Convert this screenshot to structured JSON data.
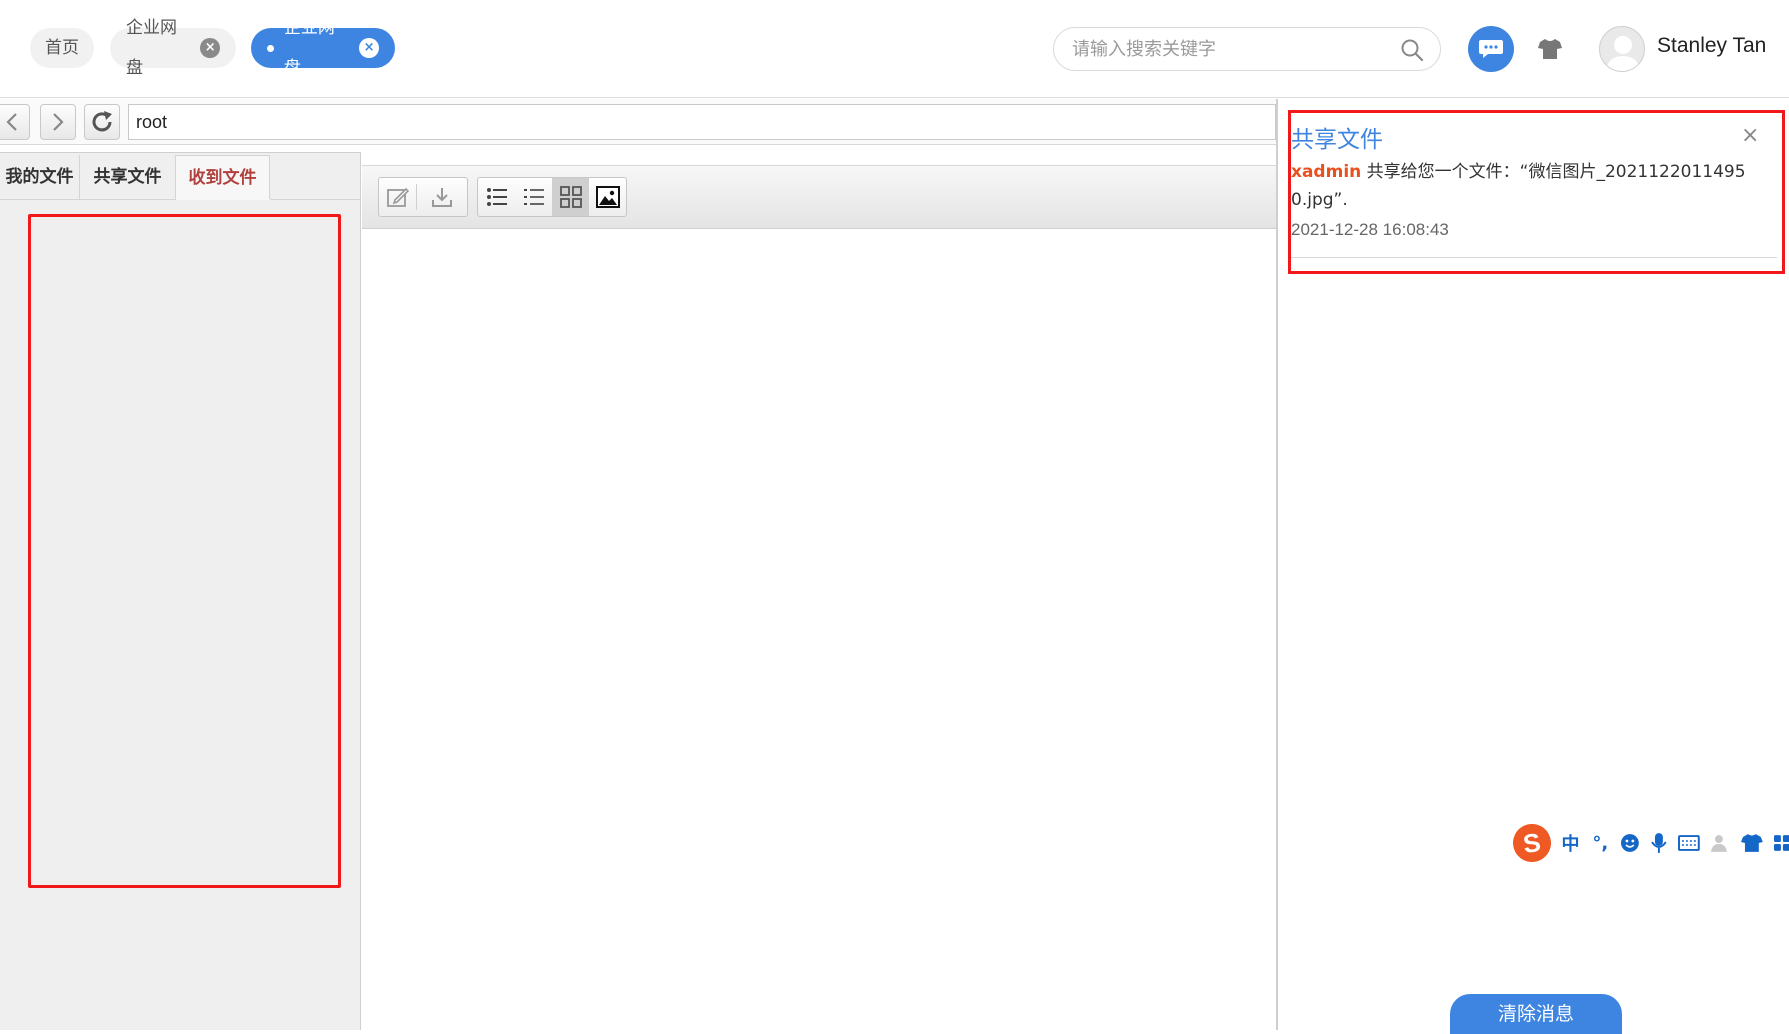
{
  "tabs": {
    "home": "首页",
    "disk1": "企业网盘",
    "disk2": "企业网盘"
  },
  "search": {
    "placeholder": "请输入搜索关键字"
  },
  "user": {
    "name": "Stanley Tan"
  },
  "address": {
    "path": "root"
  },
  "file_tabs": {
    "mine": "我的文件",
    "shared": "共享文件",
    "received": "收到文件",
    "selected": "收到文件"
  },
  "toolbar": {
    "icons": [
      "edit-icon",
      "download-icon",
      "list-icon",
      "detail-list-icon",
      "grid-icon",
      "image-view-icon"
    ],
    "selected_view": "grid"
  },
  "notification": {
    "title": "共享文件",
    "close": "×",
    "sender": "xadmin",
    "message": " 共享给您一个文件：“微信图片_20211220114950.jpg”.",
    "time": "2021-12-28 16:08:43"
  },
  "ime": {
    "logo": "S",
    "items": [
      "中",
      "°,"
    ]
  },
  "clear_button": "清除消息",
  "colors": {
    "accent": "#3d85e0",
    "highlight_red": "#f01818",
    "sender": "#e8501f",
    "active_tab_text": "#b0413e"
  }
}
